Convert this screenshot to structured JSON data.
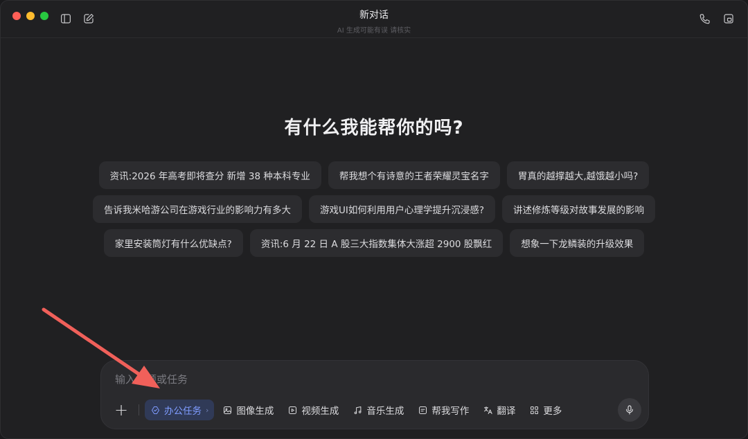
{
  "window": {
    "title": "新对话",
    "subtitle": "AI 生成可能有误 请核实"
  },
  "titlebar_icons": [
    "sidebar-toggle-icon",
    "new-chat-icon",
    "phone-icon",
    "window-icon"
  ],
  "main": {
    "heading": "有什么我能帮你的吗?",
    "suggestions": {
      "row1": [
        "资讯:2026 年高考即将查分 新增 38 种本科专业",
        "帮我想个有诗意的王者荣耀灵宝名字",
        "胃真的越撑越大,越饿越小吗?"
      ],
      "row2": [
        "告诉我米哈游公司在游戏行业的影响力有多大",
        "游戏UI如何利用用户心理学提升沉浸感?",
        "讲述修炼等级对故事发展的影响"
      ],
      "row3": [
        "家里安装筒灯有什么优缺点?",
        "资讯:6 月 22 日 A 股三大指数集体大涨超 2900 股飘红",
        "想象一下龙鳞装的升级效果"
      ]
    }
  },
  "composer": {
    "placeholder": "输入问题或任务",
    "plus_label": "+",
    "tools": {
      "office": "办公任务",
      "office_chevron": "›",
      "image": "图像生成",
      "video": "视频生成",
      "music": "音乐生成",
      "write": "帮我写作",
      "translate": "翻译",
      "more": "更多"
    },
    "active_tool": "office"
  },
  "colors": {
    "background": "#202022",
    "chip": "#2c2c2f",
    "accent": "#7f9cff",
    "annotation_arrow": "#f0605a"
  }
}
